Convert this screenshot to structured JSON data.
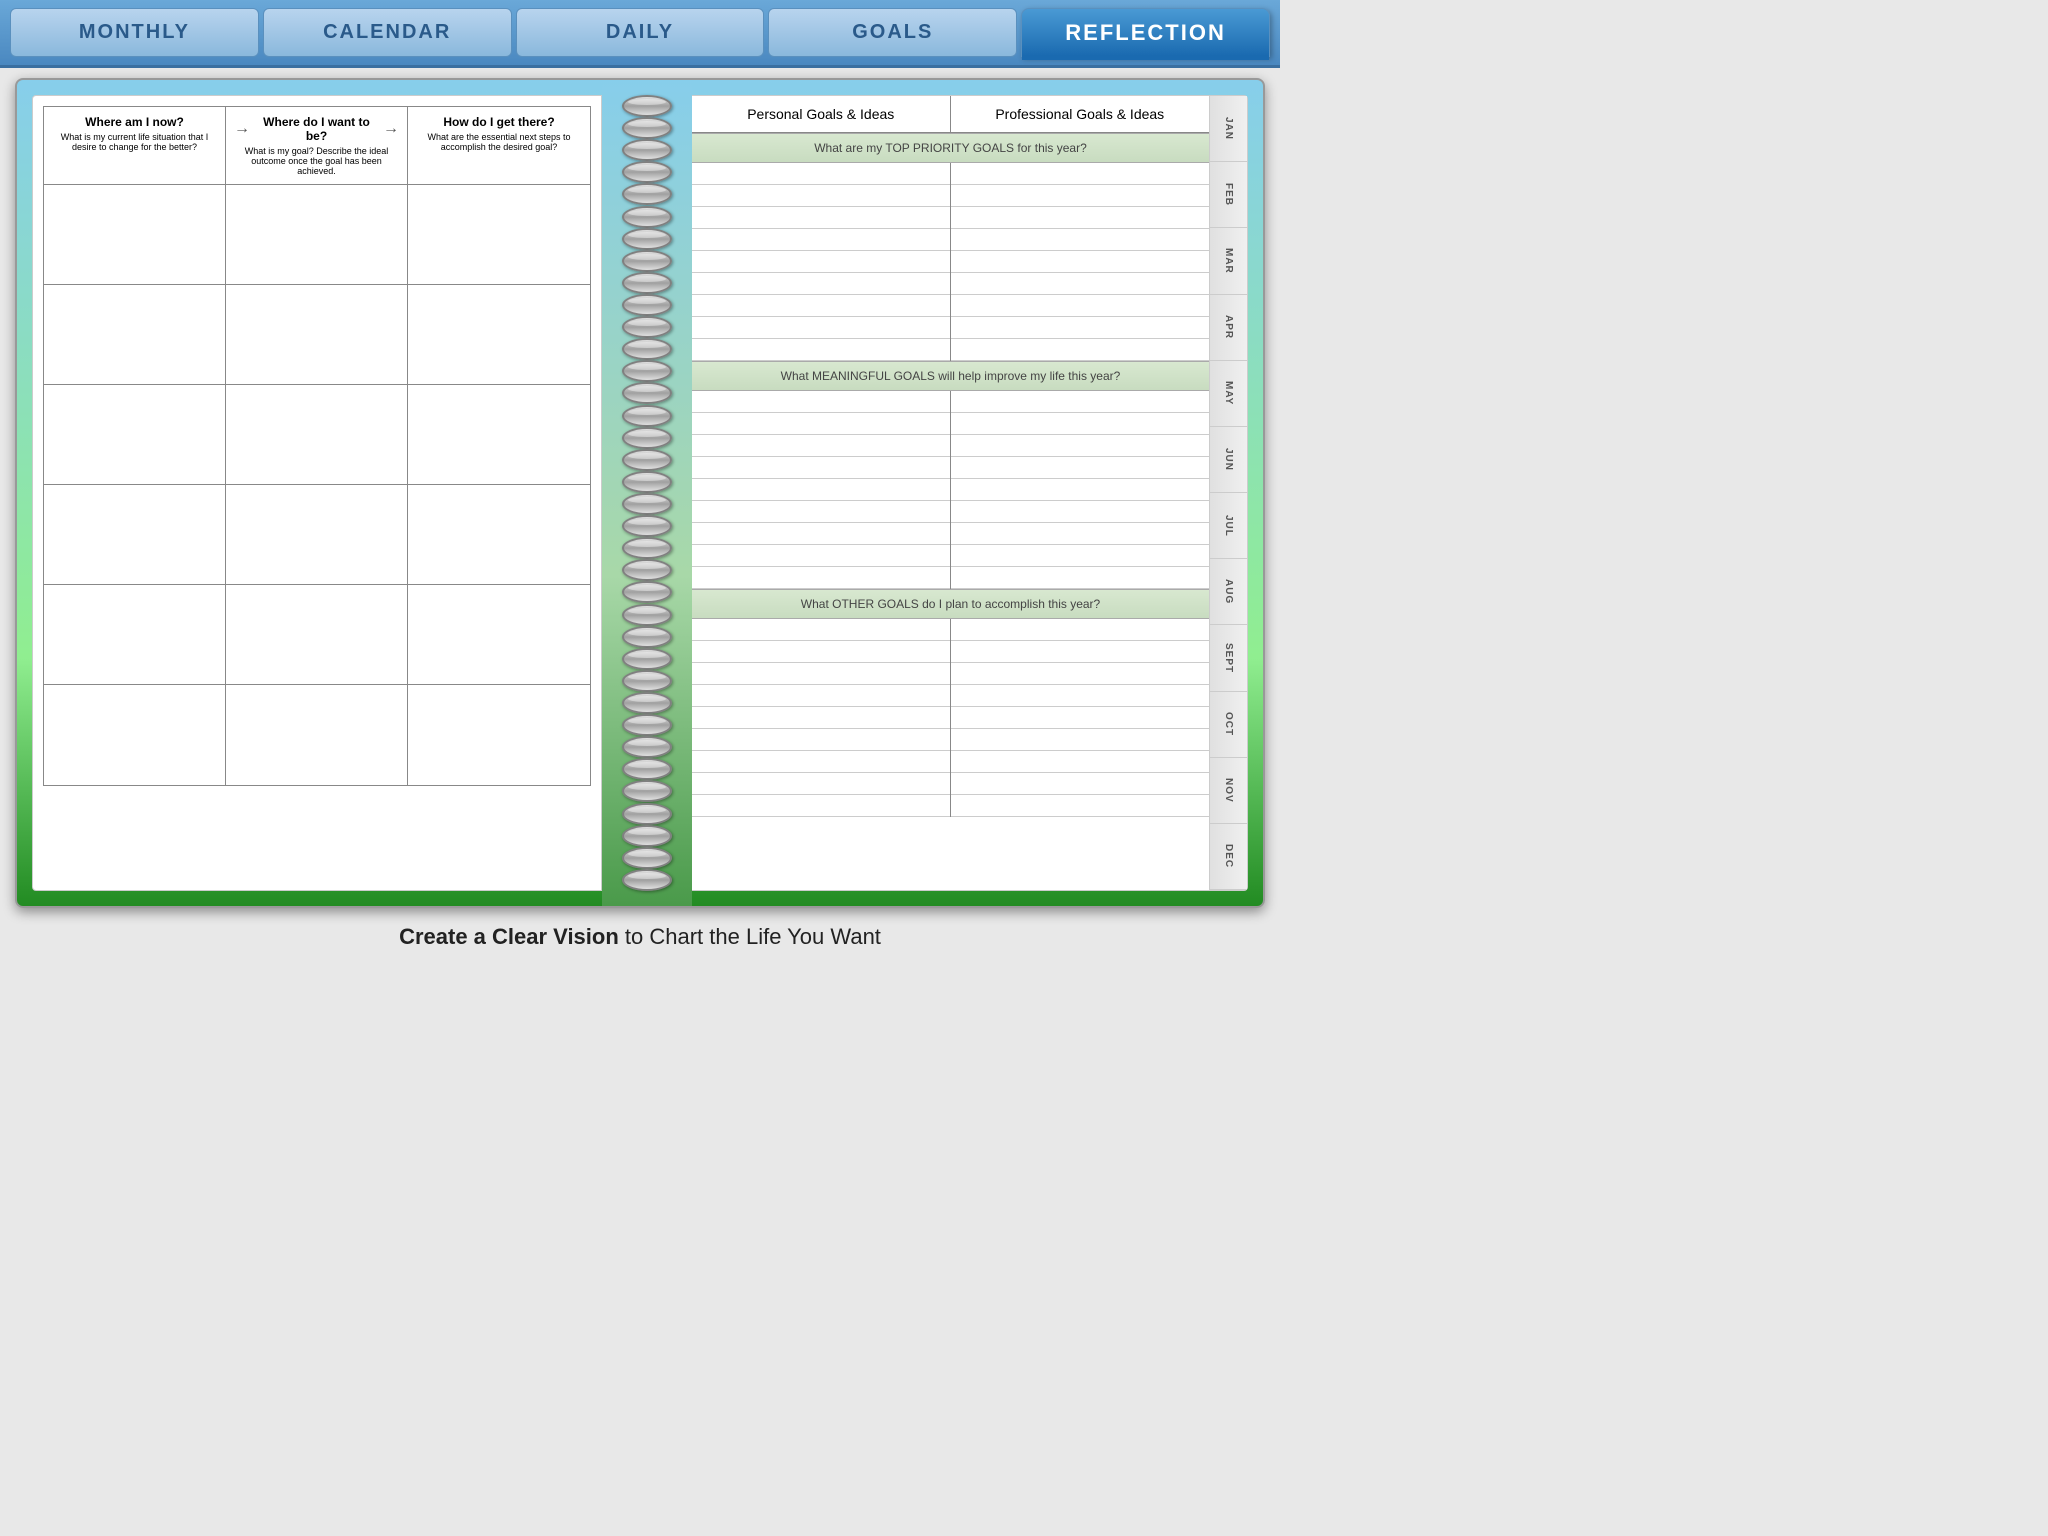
{
  "nav": {
    "tabs": [
      {
        "id": "monthly",
        "label": "MONTHLY",
        "active": false
      },
      {
        "id": "calendar",
        "label": "CALENDAR",
        "active": false
      },
      {
        "id": "daily",
        "label": "DAILY",
        "active": false
      },
      {
        "id": "goals",
        "label": "GOALS",
        "active": false
      },
      {
        "id": "reflection",
        "label": "REFLECTION",
        "active": true
      }
    ]
  },
  "left_page": {
    "header": {
      "col1": {
        "question": "Where am I now?",
        "sub": "What is my current life situation that I desire to change for the better?"
      },
      "col2": {
        "question": "Where do I want to be?",
        "sub": "What is my goal? Describe the ideal outcome once the goal has been achieved."
      },
      "col3": {
        "question": "How do I get there?",
        "sub": "What are the essential next steps to accomplish the desired goal?"
      }
    }
  },
  "right_page": {
    "col_headers": [
      "Personal Goals & Ideas",
      "Professional Goals & Ideas"
    ],
    "sections": [
      {
        "id": "top_priority",
        "header": "What are my TOP PRIORITY GOALS for this year?",
        "lines": 9
      },
      {
        "id": "meaningful",
        "header": "What MEANINGFUL GOALS will help improve my life this year?",
        "lines": 9
      },
      {
        "id": "other",
        "header": "What OTHER GOALS do I plan to accomplish this year?",
        "lines": 9
      }
    ]
  },
  "month_tabs": [
    "JAN",
    "FEB",
    "MAR",
    "APR",
    "MAY",
    "JUN",
    "JUL",
    "AUG",
    "SEPT",
    "OCT",
    "NOV",
    "DEC"
  ],
  "footer": {
    "bold_text": "Create a Clear Vision",
    "regular_text": " to Chart the Life You Want"
  },
  "spiral_count": 36
}
